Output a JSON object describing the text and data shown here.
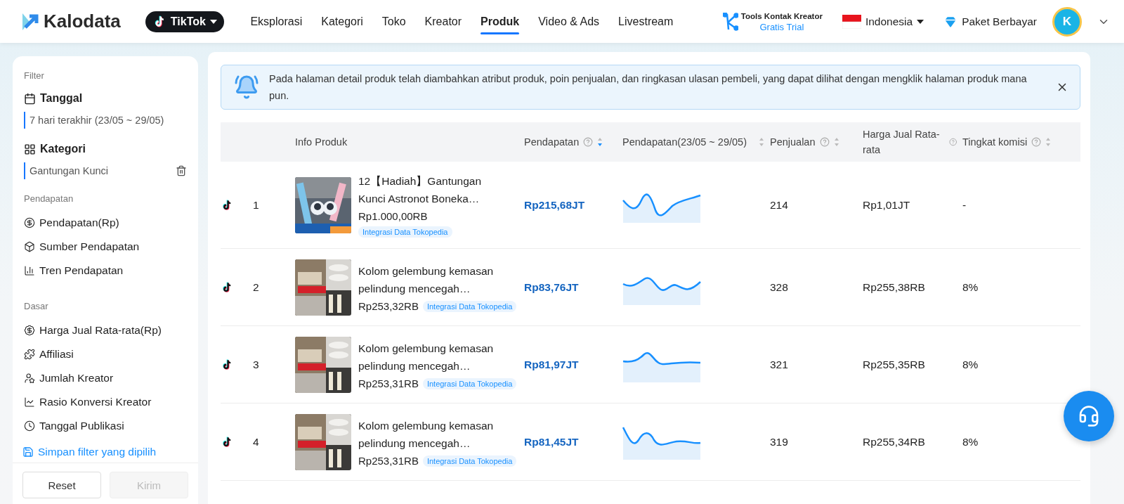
{
  "header": {
    "logo": "Kalodata",
    "platform": "TikTok",
    "nav": [
      {
        "label": "Eksplorasi",
        "selected": false
      },
      {
        "label": "Kategori",
        "selected": false
      },
      {
        "label": "Toko",
        "selected": false
      },
      {
        "label": "Kreator",
        "selected": false
      },
      {
        "label": "Produk",
        "selected": true
      },
      {
        "label": "Video & Ads",
        "selected": false
      },
      {
        "label": "Livestream",
        "selected": false
      }
    ],
    "tools": {
      "title": "Tools Kontak Kreator",
      "subtitle": "Gratis Trial"
    },
    "country": "Indonesia",
    "plan": "Paket Berbayar",
    "avatar": "K"
  },
  "sidebar": {
    "heading": "Filter",
    "filters": [
      {
        "title": "Tanggal",
        "value": "7 hari terakhir (23/05 ~ 29/05)",
        "removable": false
      },
      {
        "title": "Kategori",
        "value": "Gantungan Kunci",
        "removable": true
      }
    ],
    "sections": [
      {
        "label": "Pendapatan",
        "items": [
          "Pendapatan(Rp)",
          "Sumber Pendapatan",
          "Tren Pendapatan"
        ]
      },
      {
        "label": "Dasar",
        "items": [
          "Harga Jual Rata-rata(Rp)",
          "Affiliasi",
          "Jumlah Kreator",
          "Rasio Konversi Kreator",
          "Tanggal Publikasi"
        ]
      }
    ],
    "save_link": "Simpan filter yang dipilih",
    "buttons": [
      {
        "label": "Reset",
        "disabled": false
      },
      {
        "label": "Kirim",
        "disabled": true
      }
    ]
  },
  "notice": {
    "text": "Pada halaman detail produk telah diambahkan atribut produk, poin penjualan, dan ringkasan ulasan pembeli, yang dapat dilihat dengan mengklik halaman produk mana pun."
  },
  "table": {
    "columns": [
      {
        "label": "Info Produk",
        "help": false,
        "sortable": false
      },
      {
        "label": "Pendapatan",
        "help": true,
        "sortable": true,
        "sorted": true
      },
      {
        "label": "Pendapatan(23/05 ~ 29/05)",
        "help": false,
        "sortable": true,
        "sorted": false
      },
      {
        "label": "Penjualan",
        "help": true,
        "sortable": true,
        "sorted": false
      },
      {
        "label": "Harga Jual Rata-rata",
        "help": true,
        "sortable": false
      },
      {
        "label": "Tingkat komisi",
        "help": true,
        "sortable": true,
        "sorted": false
      }
    ],
    "rows": [
      {
        "rank": "1",
        "title": "12【Hadiah】Gantungan Kunci Astronot Boneka…",
        "price": "Rp1.000,00RB",
        "badge": "Integrasi Data Tokopedia",
        "revenue": "Rp215,68JT",
        "sales": "214",
        "avg_price": "Rp1,01JT",
        "commission": "-"
      },
      {
        "rank": "2",
        "title": "Kolom gelembung kemasan pelindung mencegah…",
        "price": "Rp253,32RB",
        "badge": "Integrasi Data Tokopedia",
        "revenue": "Rp83,76JT",
        "sales": "328",
        "avg_price": "Rp255,38RB",
        "commission": "8%"
      },
      {
        "rank": "3",
        "title": "Kolom gelembung kemasan pelindung mencegah…",
        "price": "Rp253,31RB",
        "badge": "Integrasi Data Tokopedia",
        "revenue": "Rp81,97JT",
        "sales": "321",
        "avg_price": "Rp255,35RB",
        "commission": "8%"
      },
      {
        "rank": "4",
        "title": "Kolom gelembung kemasan pelindung mencegah…",
        "price": "Rp253,31RB",
        "badge": "Integrasi Data Tokopedia",
        "revenue": "Rp81,45JT",
        "sales": "319",
        "avg_price": "Rp255,34RB",
        "commission": "8%"
      }
    ]
  }
}
